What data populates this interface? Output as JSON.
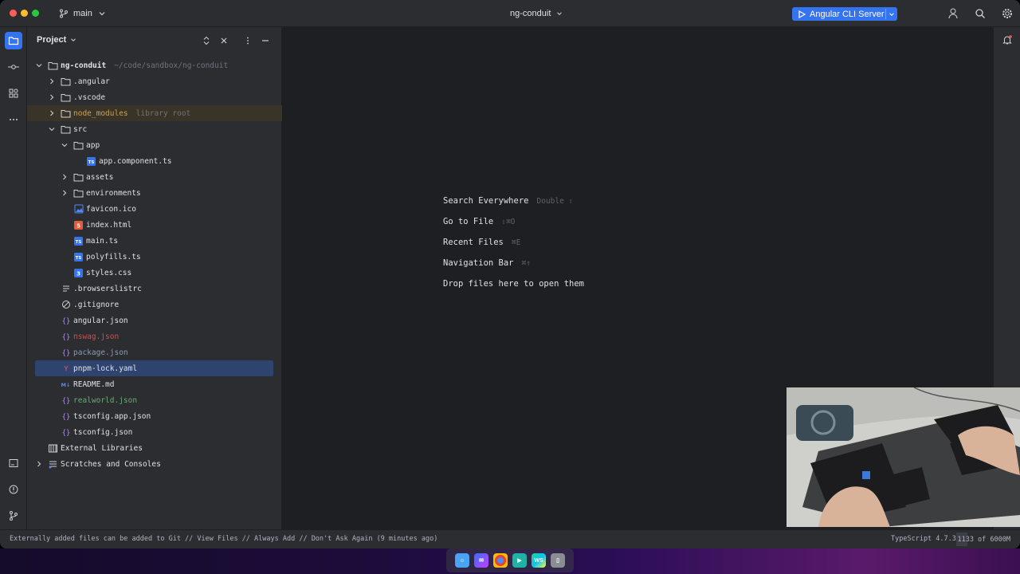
{
  "titlebar": {
    "branch": "main",
    "project": "ng-conduit",
    "run_config": "Angular CLI Server"
  },
  "project_panel": {
    "title": "Project"
  },
  "tree": [
    {
      "label": "ng-conduit",
      "hint": "~/code/sandbox/ng-conduit",
      "depth": 0,
      "kind": "folder",
      "expanded": true,
      "bold": true
    },
    {
      "label": ".angular",
      "depth": 1,
      "kind": "folder",
      "expanded": false
    },
    {
      "label": ".vscode",
      "depth": 1,
      "kind": "folder",
      "expanded": false
    },
    {
      "label": "node_modules",
      "hint": "library root",
      "depth": 1,
      "kind": "folder",
      "expanded": false,
      "style": "excluded"
    },
    {
      "label": "src",
      "depth": 1,
      "kind": "folder",
      "expanded": true
    },
    {
      "label": "app",
      "depth": 2,
      "kind": "folder",
      "expanded": true
    },
    {
      "label": "app.component.ts",
      "depth": 3,
      "kind": "ts"
    },
    {
      "label": "assets",
      "depth": 2,
      "kind": "folder",
      "expanded": false
    },
    {
      "label": "environments",
      "depth": 2,
      "kind": "folder",
      "expanded": false
    },
    {
      "label": "favicon.ico",
      "depth": 2,
      "kind": "image"
    },
    {
      "label": "index.html",
      "depth": 2,
      "kind": "html"
    },
    {
      "label": "main.ts",
      "depth": 2,
      "kind": "ts"
    },
    {
      "label": "polyfills.ts",
      "depth": 2,
      "kind": "ts"
    },
    {
      "label": "styles.css",
      "depth": 2,
      "kind": "css"
    },
    {
      "label": ".browserslistrc",
      "depth": 1,
      "kind": "text"
    },
    {
      "label": ".gitignore",
      "depth": 1,
      "kind": "ignore"
    },
    {
      "label": "angular.json",
      "depth": 1,
      "kind": "json"
    },
    {
      "label": "nswag.json",
      "depth": 1,
      "kind": "json",
      "color": "red"
    },
    {
      "label": "package.json",
      "depth": 1,
      "kind": "json",
      "color": "muted"
    },
    {
      "label": "pnpm-lock.yaml",
      "depth": 1,
      "kind": "yaml",
      "selected": true
    },
    {
      "label": "README.md",
      "depth": 1,
      "kind": "md"
    },
    {
      "label": "realworld.json",
      "depth": 1,
      "kind": "json",
      "color": "green"
    },
    {
      "label": "tsconfig.app.json",
      "depth": 1,
      "kind": "json"
    },
    {
      "label": "tsconfig.json",
      "depth": 1,
      "kind": "json"
    },
    {
      "label": "External Libraries",
      "depth": 0,
      "kind": "library"
    },
    {
      "label": "Scratches and Consoles",
      "depth": 0,
      "kind": "scratches",
      "expanded": false
    }
  ],
  "editor_hints": [
    {
      "label": "Search Everywhere",
      "shortcut": "Double ⇧"
    },
    {
      "label": "Go to File",
      "shortcut": "⇧⌘O"
    },
    {
      "label": "Recent Files",
      "shortcut": "⌘E"
    },
    {
      "label": "Navigation Bar",
      "shortcut": "⌘↑"
    },
    {
      "label": "Drop files here to open them",
      "shortcut": ""
    }
  ],
  "statusbar": {
    "message": "Externally added files can be added to Git // View Files // Always Add // Don't Ask Again (9 minutes ago)",
    "language": "TypeScript 4.7.3",
    "memory": "1133 of 6000M",
    "memory_fraction": 0.19
  },
  "colors": {
    "accent": "#3574f0",
    "selection": "#2e436e",
    "excluded": "#3a3327"
  }
}
